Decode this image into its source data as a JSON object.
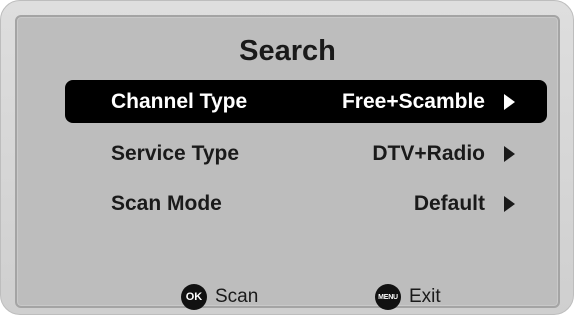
{
  "dialog": {
    "title": "Search"
  },
  "menu": {
    "items": [
      {
        "label": "Channel Type",
        "value": "Free+Scamble",
        "selected": true
      },
      {
        "label": "Service Type",
        "value": "DTV+Radio",
        "selected": false
      },
      {
        "label": "Scan Mode",
        "value": "Default",
        "selected": false
      }
    ]
  },
  "footer": {
    "ok_badge": "OK",
    "ok_label": "Scan",
    "menu_badge": "MENU",
    "menu_label": "Exit"
  },
  "colors": {
    "panel_background": "#bdbdbd",
    "selection_background": "#000000",
    "selection_text": "#ffffff",
    "text": "#1a1a1a"
  },
  "icons": {
    "row_arrow": "triangle-right-icon",
    "ok_button": "ok-button-icon",
    "menu_button": "menu-button-icon"
  }
}
